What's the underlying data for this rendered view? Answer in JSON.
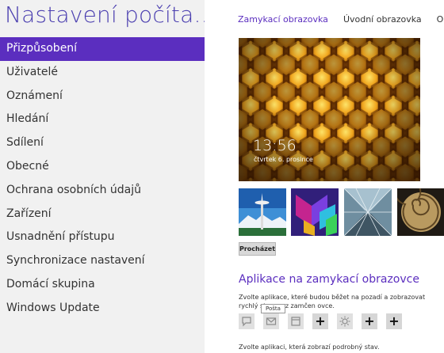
{
  "left_pane": {
    "title": "Nastavení počíta...",
    "nav_items": [
      "Přizpůsobení",
      "Uživatelé",
      "Oznámení",
      "Hledání",
      "Sdílení",
      "Obecné",
      "Ochrana osobních údajů",
      "Zařízení",
      "Usnadnění přístupu",
      "Synchronizace nastavení",
      "Domácí skupina",
      "Windows Update"
    ],
    "selected_index": 0
  },
  "right_pane": {
    "tabs": [
      "Zamykací obrazovka",
      "Úvodní obrazovka",
      "Obráz"
    ],
    "active_tab_index": 0,
    "lock_preview": {
      "time": "13:56",
      "date": "čtvrtek 6. prosince"
    },
    "thumbnails": [
      "space-needle-image",
      "purple-tiles-image",
      "glass-structure-image",
      "nautilus-shell-image"
    ],
    "browse_label": "Procházet",
    "apps_section": {
      "heading": "Aplikace na zamykací obrazovce",
      "description": "Zvolte aplikace, které budou běžet na pozadí a zobrazovat rychlý stav a oz zamčen    ovce.",
      "tooltip": "Pošta",
      "slots": [
        "message-icon",
        "mail-icon",
        "calendar-icon",
        "plus",
        "weather-icon",
        "plus",
        "plus"
      ],
      "detail_text": "Zvolte aplikaci, která zobrazí podrobný stav."
    }
  },
  "colors": {
    "accent": "#5b2ebf",
    "title": "#4b3fb0",
    "left_bg": "#f1f1f1"
  }
}
